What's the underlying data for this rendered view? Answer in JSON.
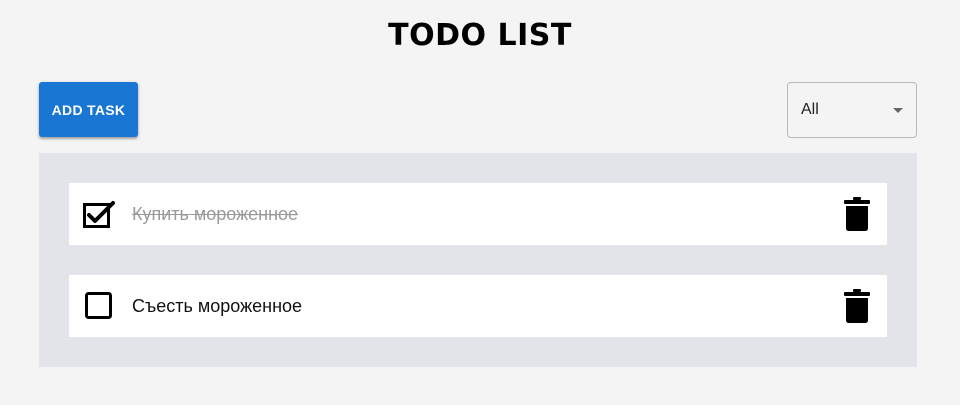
{
  "header": {
    "title": "TODO LIST"
  },
  "toolbar": {
    "add_task_label": "ADD TASK",
    "filter": {
      "selected": "All",
      "icon": "chevron-down-icon"
    }
  },
  "tasks": [
    {
      "label": "Купить мороженное",
      "completed": true,
      "delete_icon": "trash-icon"
    },
    {
      "label": "Съесть мороженное",
      "completed": false,
      "delete_icon": "trash-icon"
    }
  ],
  "colors": {
    "accent": "#1976d2",
    "background": "#f4f4f4",
    "list_background": "#e3e3ea",
    "completed_text": "#9a9a9a"
  }
}
